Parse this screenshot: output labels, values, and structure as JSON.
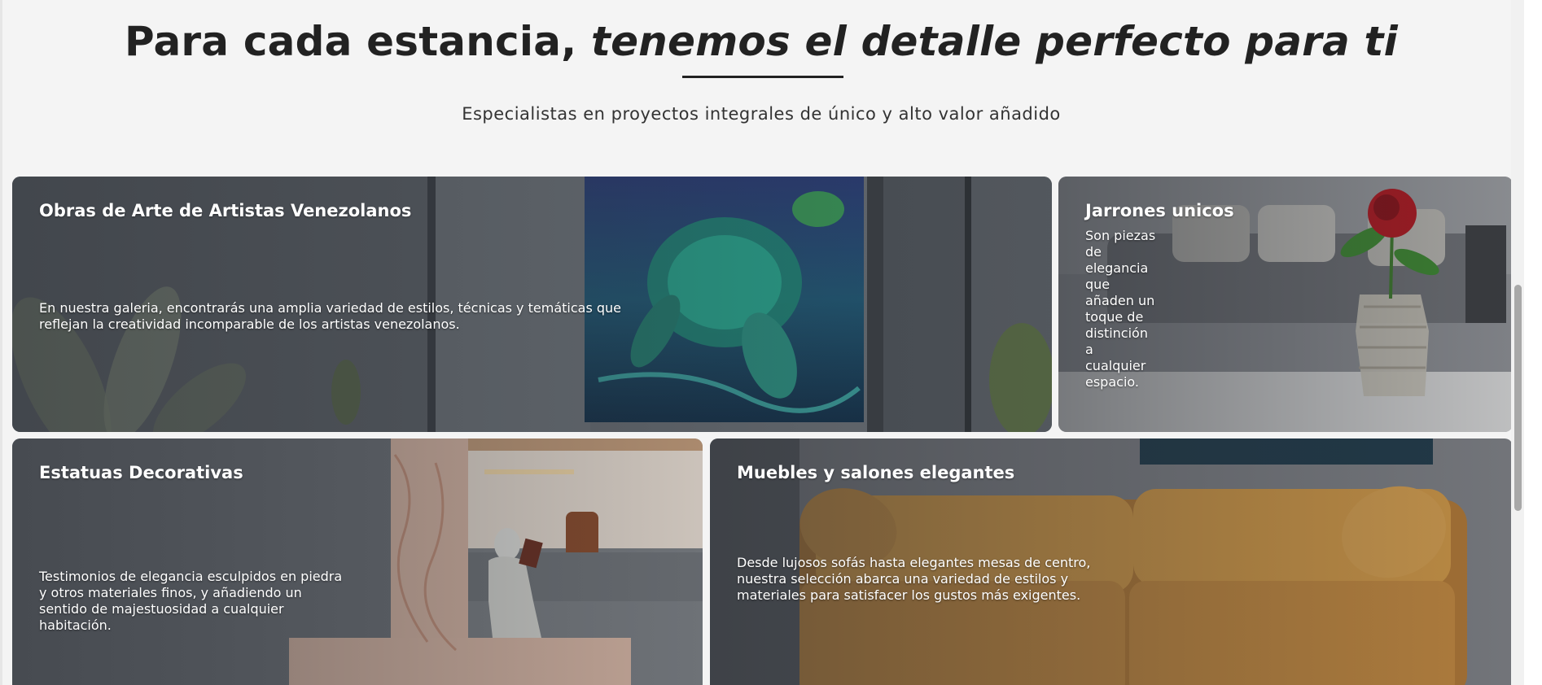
{
  "header": {
    "title_plain": "Para cada estancia, ",
    "title_italic": "tenemos el detalle perfecto para ti",
    "subtitle": "Especialistas en proyectos integrales de único y alto valor añadido"
  },
  "cards": [
    {
      "title": "Obras de Arte de Artistas Venezolanos",
      "description": "En nuestra galeria, encontrarás una amplia variedad de estilos, técnicas y temáticas que reflejan la creatividad incomparable de los artistas venezolanos."
    },
    {
      "title": "Jarrones unicos",
      "description": "Son piezas de elegancia que añaden un toque de distinción a cualquier espacio."
    },
    {
      "title": "Estatuas Decorativas",
      "description": "Testimonios de elegancia esculpidos en piedra y otros materiales finos, y añadiendo un sentido de majestuosidad a cualquier habitación."
    },
    {
      "title": "Muebles y salones elegantes",
      "description": "Desde lujosos sofás hasta elegantes mesas de centro, nuestra selección abarca una variedad de estilos y materiales para satisfacer los gustos más exigentes."
    }
  ],
  "colors": {
    "background": "#f4f4f4",
    "heading": "#222222",
    "sofa": "#d49a46"
  }
}
